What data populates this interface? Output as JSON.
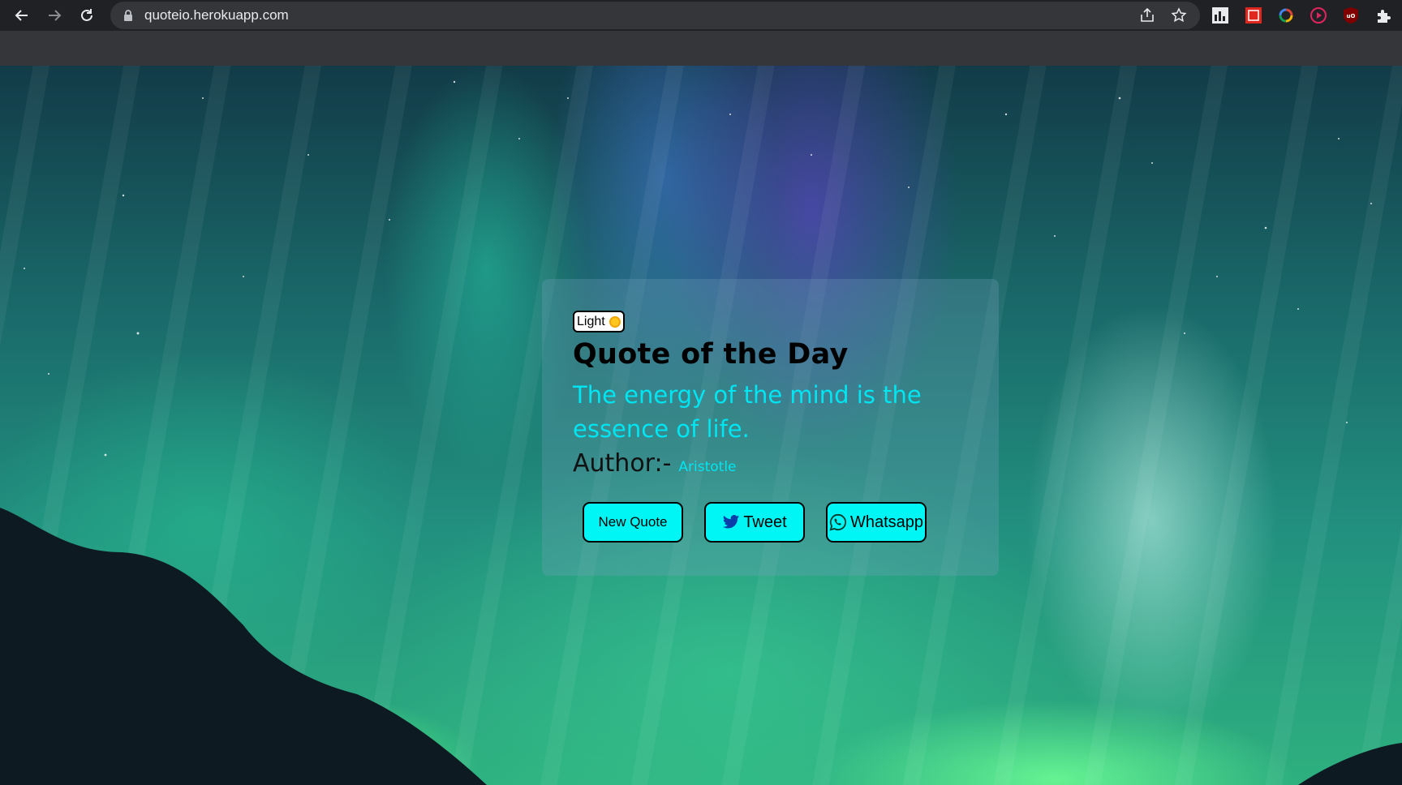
{
  "browser": {
    "url": "quoteio.herokuapp.com",
    "icons": [
      "back-icon",
      "forward-icon",
      "reload-icon",
      "lock-icon",
      "share-icon",
      "bookmark-star-icon",
      "extension-chart-icon",
      "extension-pdf-icon",
      "extension-color-icon",
      "extension-play-icon",
      "extension-ublock-icon",
      "extensions-puzzle-icon"
    ]
  },
  "card": {
    "theme_toggle_label": "Light",
    "title": "Quote of the Day",
    "quote": "The energy of the mind is the essence of life.",
    "author_label": "Author:-",
    "author_name": "Aristotle",
    "buttons": {
      "new_quote": "New Quote",
      "tweet": "Tweet",
      "whatsapp": "Whatsapp"
    }
  },
  "colors": {
    "accent": "#00f5f5",
    "quote_text": "#00e5f2",
    "chrome_dark": "#202124",
    "chrome_tab_strip": "#35363a"
  }
}
